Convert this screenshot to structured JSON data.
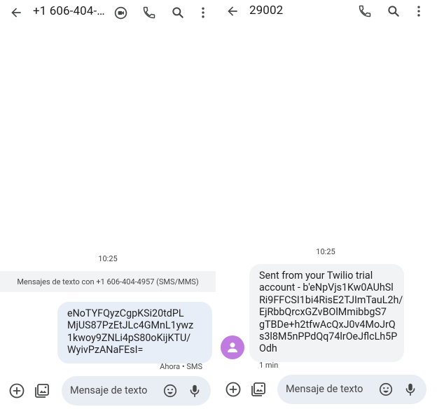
{
  "left_thread": {
    "title": "+1 606-404-…",
    "timestamp": "10:25",
    "info_banner": "Mensajes de texto con +1 606-404-4957 (SMS/MMS)",
    "sent_message": "eNoTYFQyzCgpKSi20tdPL\nMjUS87PzEtJLc4GMnL1ywz\n1kwoy9ZNLi4pS80oKijKTU/\nWyivPzANaFEsI=",
    "sent_status": "Ahora • SMS",
    "composer_placeholder": "Mensaje de texto",
    "icons": [
      "back-arrow-icon",
      "video-call-icon",
      "phone-icon",
      "search-icon",
      "more-vert-icon",
      "add-icon",
      "gallery-icon",
      "emoji-icon",
      "mic-icon"
    ]
  },
  "right_thread": {
    "title": "29002",
    "timestamp": "10:25",
    "received_message": "Sent from your Twilio trial\naccount - b'eNpVjs1Kw0AUhSl\nRi9FFCSI1bi4RisE2TJImTauL2h/\nEjRbbQrcxGZvBOlMmibbgS7\ngTBDe+h2tfwAcQxJ0v4MoJrQ\ns3l8M5nPPdQq74lrOeJflcLh5P\nOdh",
    "received_time": "1 min",
    "composer_placeholder": "Mensaje de texto",
    "icons": [
      "back-arrow-icon",
      "phone-icon",
      "search-icon",
      "more-vert-icon",
      "person-icon",
      "add-icon",
      "gallery-icon",
      "emoji-icon",
      "mic-icon"
    ]
  },
  "colors": {
    "sent_bubble": "#e8eef8",
    "received_bubble": "#f1f3f4",
    "avatar": "#c07be0",
    "composer": "#e9eef5",
    "icon": "#444746"
  }
}
